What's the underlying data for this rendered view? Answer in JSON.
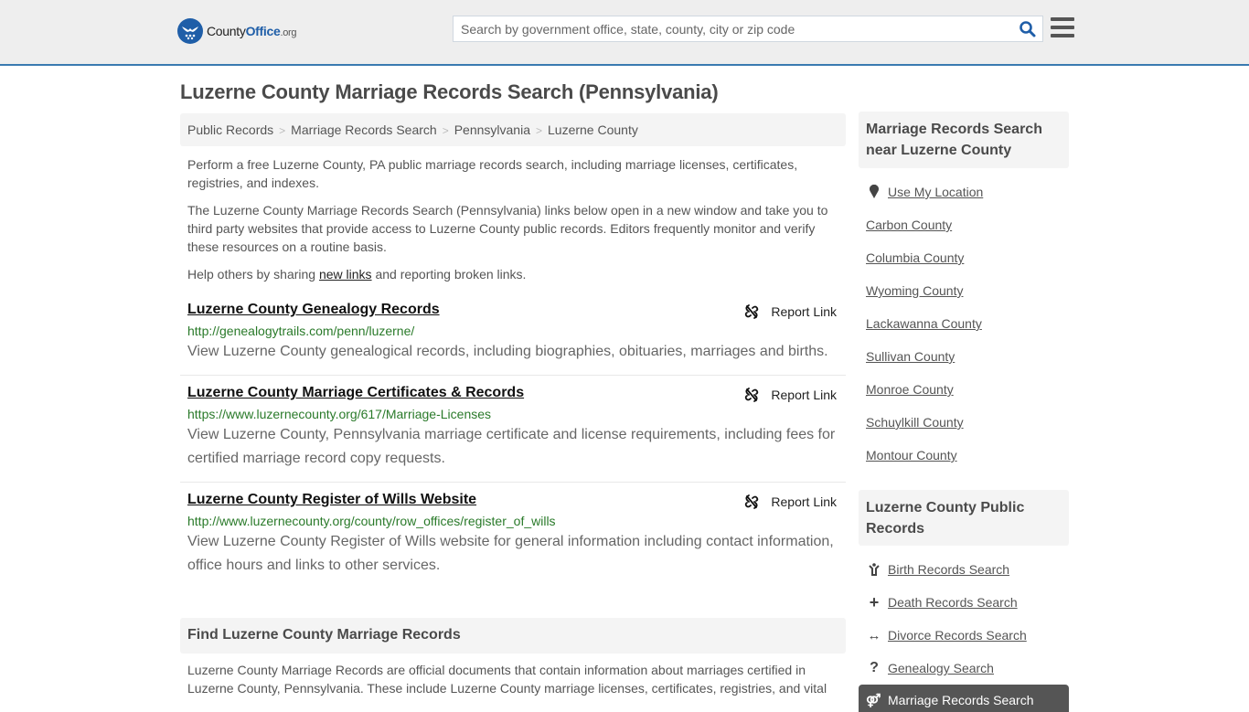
{
  "header": {
    "logo": {
      "name": "County",
      "name_bold": "Office",
      "tld": ".org"
    },
    "search": {
      "placeholder": "Search by government office, state, county, city or zip code",
      "value": ""
    },
    "search_icon": "search-icon",
    "menu_icon": "hamburger-menu-icon"
  },
  "page_title": "Luzerne County Marriage Records Search (Pennsylvania)",
  "breadcrumb": [
    "Public Records",
    "Marriage Records Search",
    "Pennsylvania",
    "Luzerne County"
  ],
  "intro": {
    "p1": "Perform a free Luzerne County, PA public marriage records search, including marriage licenses, certificates, registries, and indexes.",
    "p2": "The Luzerne County Marriage Records Search (Pennsylvania) links below open in a new window and take you to third party websites that provide access to Luzerne County public records. Editors frequently monitor and verify these resources on a routine basis.",
    "p3_before": "Help others by sharing ",
    "p3_link": "new links",
    "p3_after": " and reporting broken links."
  },
  "results": [
    {
      "title": "Luzerne County Genealogy Records",
      "url": "http://genealogytrails.com/penn/luzerne/",
      "description": "View Luzerne County genealogical records, including biographies, obituaries, marriages and births.",
      "report_label": "Report Link"
    },
    {
      "title": "Luzerne County Marriage Certificates & Records",
      "url": "https://www.luzernecounty.org/617/Marriage-Licenses",
      "description": "View Luzerne County, Pennsylvania marriage certificate and license requirements, including fees for certified marriage record copy requests.",
      "report_label": "Report Link"
    },
    {
      "title": "Luzerne County Register of Wills Website",
      "url": "http://www.luzernecounty.org/county/row_offices/register_of_wills",
      "description": "View Luzerne County Register of Wills website for general information including contact information, office hours and links to other services.",
      "report_label": "Report Link"
    }
  ],
  "find_section": {
    "heading": "Find Luzerne County Marriage Records",
    "body": "Luzerne County Marriage Records are official documents that contain information about marriages certified in Luzerne County, Pennsylvania. These include Luzerne County marriage licenses, certificates, registries, and vital"
  },
  "sidebar": {
    "nearby_heading": "Marriage Records Search near Luzerne County",
    "use_location": "Use My Location",
    "nearby": [
      "Carbon County",
      "Columbia County",
      "Wyoming County",
      "Lackawanna County",
      "Sullivan County",
      "Monroe County",
      "Schuylkill County",
      "Montour County"
    ],
    "public_heading": "Luzerne County Public Records",
    "public_records": [
      {
        "label": "Birth Records Search",
        "icon": "child-icon",
        "glyph": "Y"
      },
      {
        "label": "Death Records Search",
        "icon": "cross-icon",
        "glyph": "+"
      },
      {
        "label": "Divorce Records Search",
        "icon": "double-arrow-icon",
        "glyph": "↔"
      },
      {
        "label": "Genealogy Search",
        "icon": "question-icon",
        "glyph": "?"
      }
    ],
    "active": {
      "label": "Marriage Records Search",
      "icon": "marriage-symbol-icon",
      "glyph": "⚤"
    }
  },
  "colors": {
    "accent": "#3a7ab0",
    "logo_blue": "#1f5ea8",
    "url_green": "#2a7a2a",
    "active_bg": "#555555"
  }
}
